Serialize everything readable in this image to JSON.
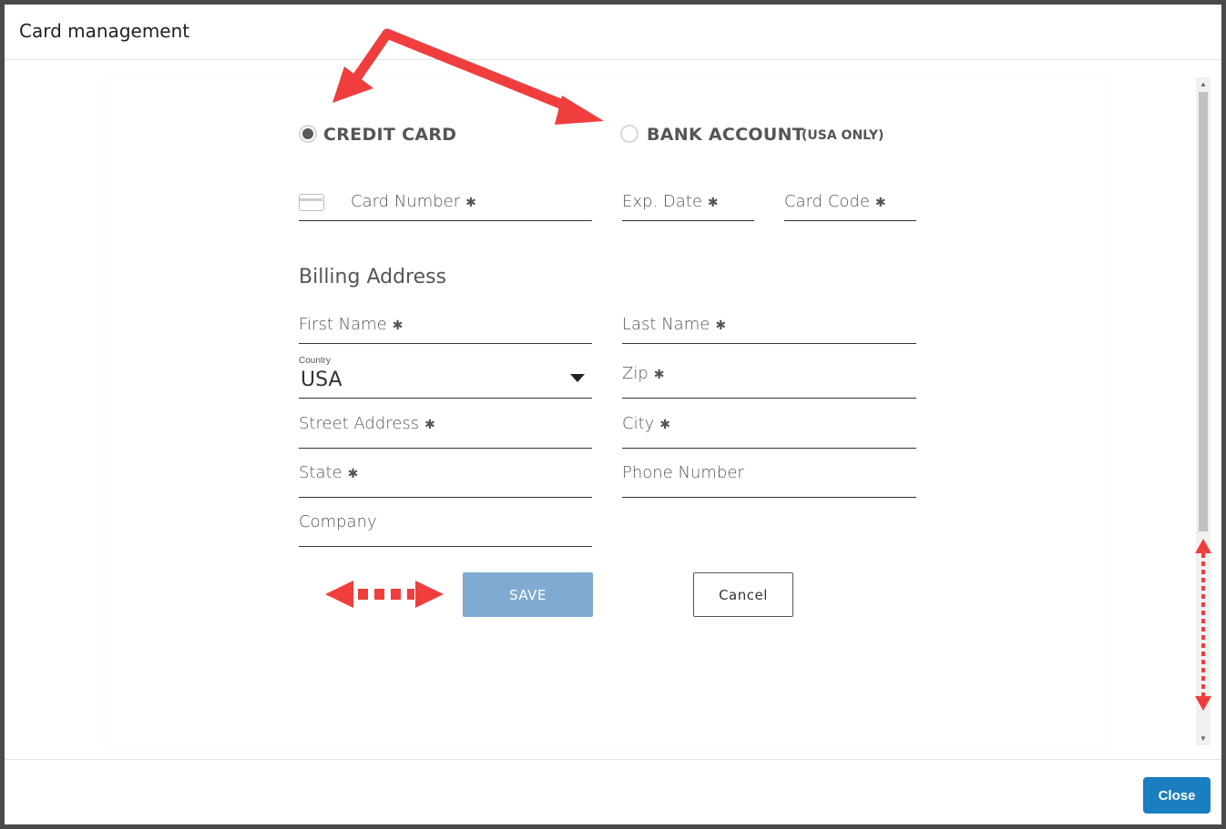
{
  "dialog": {
    "title": "Card management",
    "close_label": "Close"
  },
  "payment_type": {
    "options": [
      {
        "label": "CREDIT CARD",
        "selected": true
      },
      {
        "label": "BANK ACCOUNT",
        "note": "(USA ONLY)",
        "selected": false
      }
    ]
  },
  "card": {
    "number_label": "Card Number",
    "exp_label": "Exp. Date",
    "code_label": "Card Code",
    "required_mark": "✱"
  },
  "billing": {
    "title": "Billing Address",
    "first_name": "First Name",
    "last_name": "Last Name",
    "country_label": "Country",
    "country_value": "USA",
    "zip": "Zip",
    "street": "Street Address",
    "city": "City",
    "state": "State",
    "phone": "Phone Number",
    "company": "Company"
  },
  "actions": {
    "save_label": "SAVE",
    "cancel_label": "Cancel"
  },
  "colors": {
    "primary": "#1a7ec0",
    "save_disabled": "#80aad2",
    "annotation_arrow": "#f03e3e"
  }
}
